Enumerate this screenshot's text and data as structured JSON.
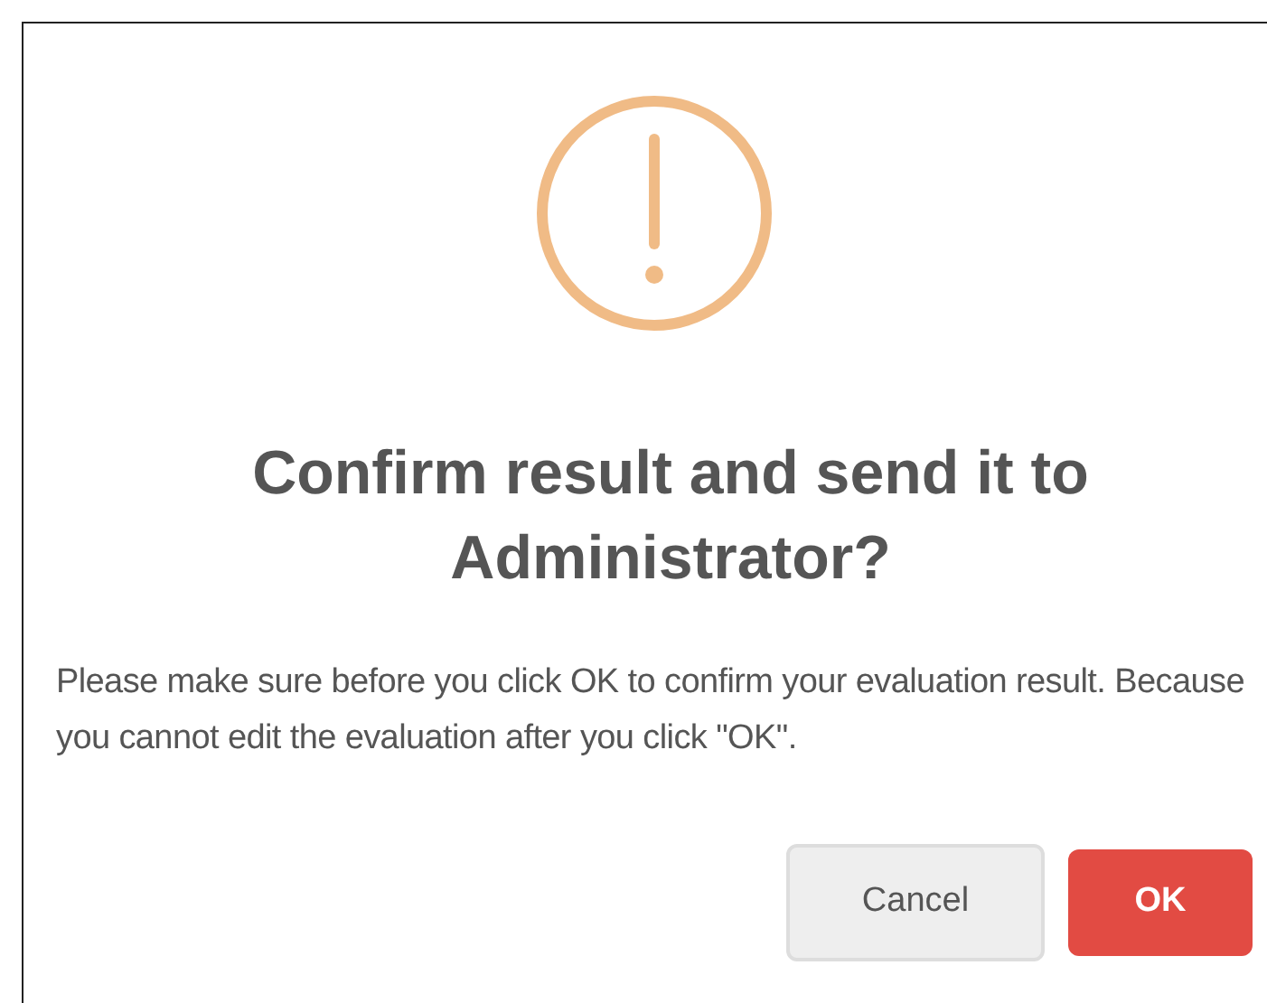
{
  "dialog": {
    "title": "Confirm result and send it to Administrator?",
    "message": "Please make sure before you click OK to confirm your evaluation result. Because you cannot edit the evaluation after you click \"OK\".",
    "buttons": [
      {
        "label": "Cancel",
        "kind": "secondary"
      },
      {
        "label": "OK",
        "kind": "primary"
      }
    ]
  }
}
